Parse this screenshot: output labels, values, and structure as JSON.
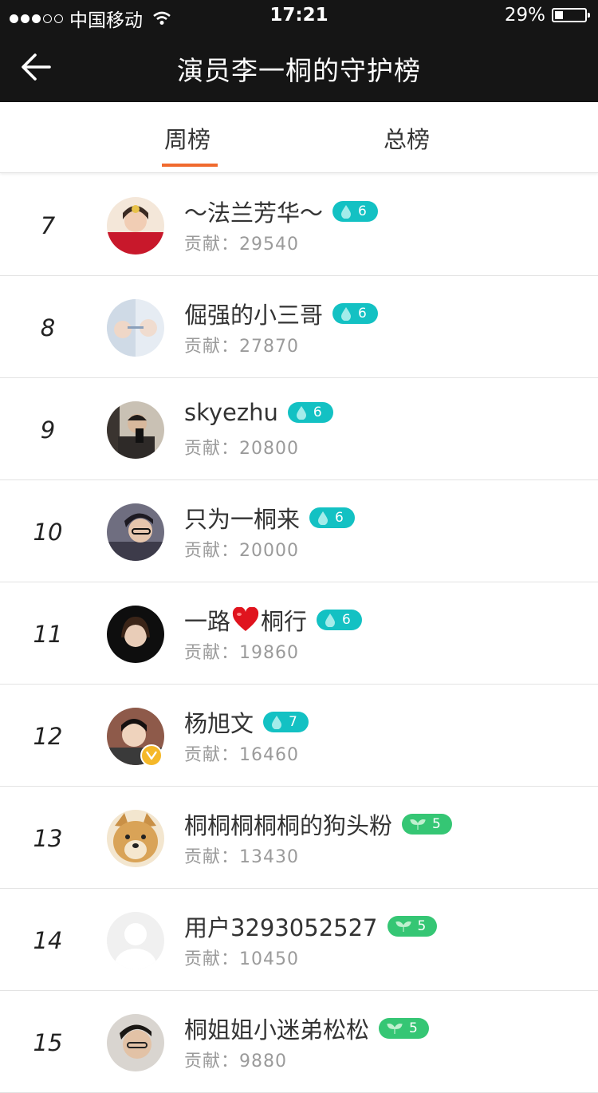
{
  "status_bar": {
    "carrier": "中国移动",
    "time": "17:21",
    "battery": "29%"
  },
  "nav": {
    "title": "演员李一桐的守护榜",
    "back_icon": "arrow-left-icon"
  },
  "tabs": [
    {
      "label": "周榜",
      "active": true
    },
    {
      "label": "总榜",
      "active": false
    }
  ],
  "colors": {
    "accent": "#f06a2e",
    "drop_badge": "#13c1c3",
    "leaf_badge": "#35c674"
  },
  "contrib_label": "贡献：",
  "rows": [
    {
      "rank": "7",
      "name": "～法兰芳华～",
      "level": "6",
      "badge_icon": "drop-icon",
      "contrib": "29540"
    },
    {
      "rank": "8",
      "name": "倔强的小三哥",
      "level": "6",
      "badge_icon": "drop-icon",
      "contrib": "27870"
    },
    {
      "rank": "9",
      "name": "skyezhu",
      "level": "6",
      "badge_icon": "drop-icon",
      "contrib": "20800"
    },
    {
      "rank": "10",
      "name": "只为一桐来",
      "level": "6",
      "badge_icon": "drop-icon",
      "contrib": "20000"
    },
    {
      "rank": "11",
      "name_before": "一路",
      "name_after": "桐行",
      "level": "6",
      "badge_icon": "drop-icon",
      "contrib": "19860"
    },
    {
      "rank": "12",
      "name": "杨旭文",
      "level": "7",
      "badge_icon": "drop-icon",
      "contrib": "16460",
      "verified_mark": "V"
    },
    {
      "rank": "13",
      "name": "桐桐桐桐桐的狗头粉",
      "level": "5",
      "badge_icon": "leaf-icon",
      "contrib": "13430"
    },
    {
      "rank": "14",
      "name": "用户3293052527",
      "level": "5",
      "badge_icon": "leaf-icon",
      "contrib": "10450"
    },
    {
      "rank": "15",
      "name": "桐姐姐小迷弟松松",
      "level": "5",
      "badge_icon": "leaf-icon",
      "contrib": "9880"
    }
  ]
}
